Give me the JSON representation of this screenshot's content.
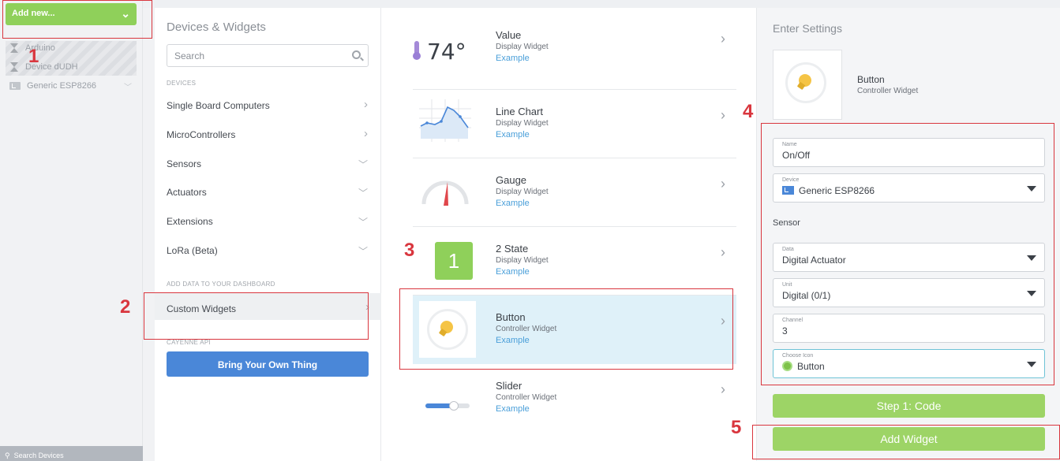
{
  "sidebar": {
    "add_new_label": "Add new...",
    "devices": [
      "Arduino",
      "Device dUDH",
      "Generic ESP8266"
    ],
    "search_label": "Search Devices"
  },
  "catalog": {
    "title": "Devices & Widgets",
    "search_placeholder": "Search",
    "devices_section": "DEVICES",
    "categories": [
      "Single Board Computers",
      "MicroControllers",
      "Sensors",
      "Actuators",
      "Extensions",
      "LoRa (Beta)"
    ],
    "dashboard_section": "ADD DATA TO YOUR DASHBOARD",
    "custom_widgets": "Custom Widgets",
    "api_section": "CAYENNE API",
    "byot_label": "Bring Your Own Thing"
  },
  "widgets": [
    {
      "name": "Value",
      "type": "Display Widget",
      "example": "Example",
      "thumb_text": "74°"
    },
    {
      "name": "Line Chart",
      "type": "Display Widget",
      "example": "Example"
    },
    {
      "name": "Gauge",
      "type": "Display Widget",
      "example": "Example"
    },
    {
      "name": "2 State",
      "type": "Display Widget",
      "example": "Example",
      "thumb_text": "1"
    },
    {
      "name": "Button",
      "type": "Controller Widget",
      "example": "Example",
      "selected": true
    },
    {
      "name": "Slider",
      "type": "Controller Widget",
      "example": "Example",
      "level": 0.65
    }
  ],
  "settings": {
    "title": "Enter Settings",
    "preview_name": "Button",
    "preview_type": "Controller Widget",
    "name_label": "Name",
    "name_value": "On/Off",
    "device_label": "Device",
    "device_value": "Generic ESP8266",
    "sensor_label": "Sensor",
    "data_label": "Data",
    "data_value": "Digital Actuator",
    "unit_label": "Unit",
    "unit_value": "Digital (0/1)",
    "channel_label": "Channel",
    "channel_value": "3",
    "icon_label": "Choose Icon",
    "icon_value": "Button",
    "step_button": "Step 1: Code",
    "add_button": "Add Widget"
  },
  "annotations": [
    "1",
    "2",
    "3",
    "4",
    "5"
  ],
  "colors": {
    "green": "#8fd05a",
    "blue": "#4a87d8",
    "annotation_red": "#d9363e",
    "selected_row": "#dff1f9"
  }
}
